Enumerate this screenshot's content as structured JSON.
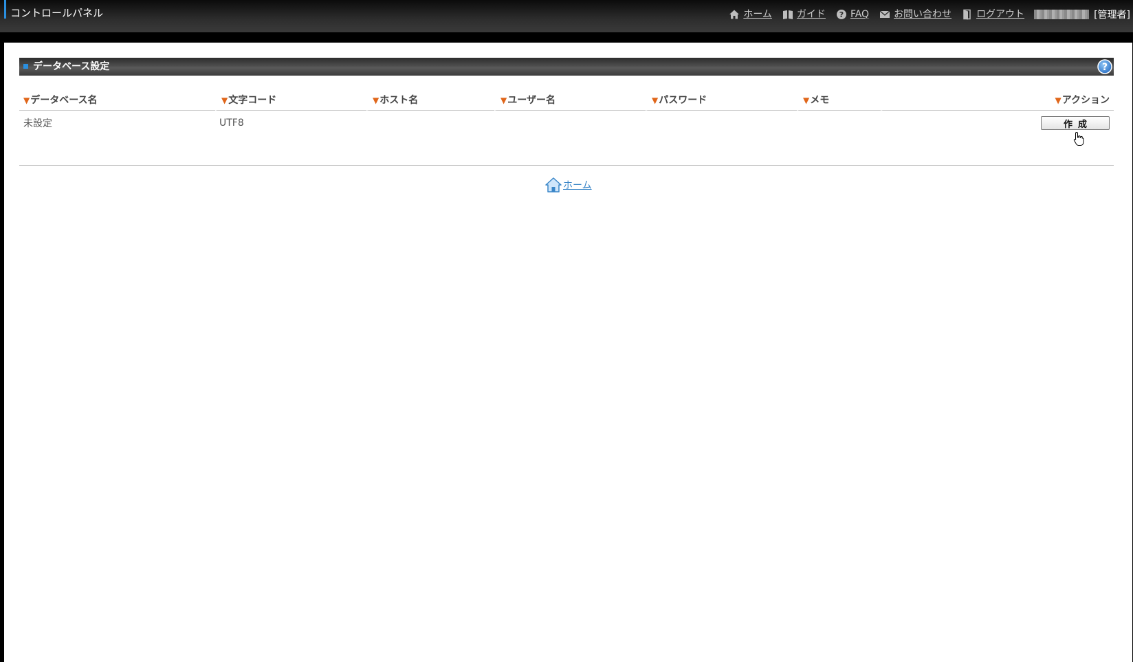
{
  "header": {
    "app_title": "コントロールパネル",
    "nav": [
      {
        "icon": "home-icon",
        "label": "ホーム"
      },
      {
        "icon": "guide-book-icon",
        "label": "ガイド"
      },
      {
        "icon": "question-circle-icon",
        "label": "FAQ"
      },
      {
        "icon": "mail-icon",
        "label": "お問い合わせ"
      },
      {
        "icon": "logout-door-icon",
        "label": "ログアウト"
      }
    ],
    "user_role": "[管理者]"
  },
  "section": {
    "title": "データベース設定",
    "help_icon": "help-icon"
  },
  "table": {
    "columns": [
      "データベース名",
      "文字コード",
      "ホスト名",
      "ユーザー名",
      "パスワード",
      "メモ",
      "アクション"
    ],
    "rows": [
      {
        "database_name": "未設定",
        "charset": "UTF8",
        "host": "",
        "user": "",
        "password": "",
        "memo": "",
        "action_label": "作成"
      }
    ]
  },
  "footer": {
    "home_label": "ホーム"
  },
  "colors": {
    "accent": "#2a8fe0",
    "sort_triangle": "#e0661a",
    "link": "#3a86c8"
  }
}
